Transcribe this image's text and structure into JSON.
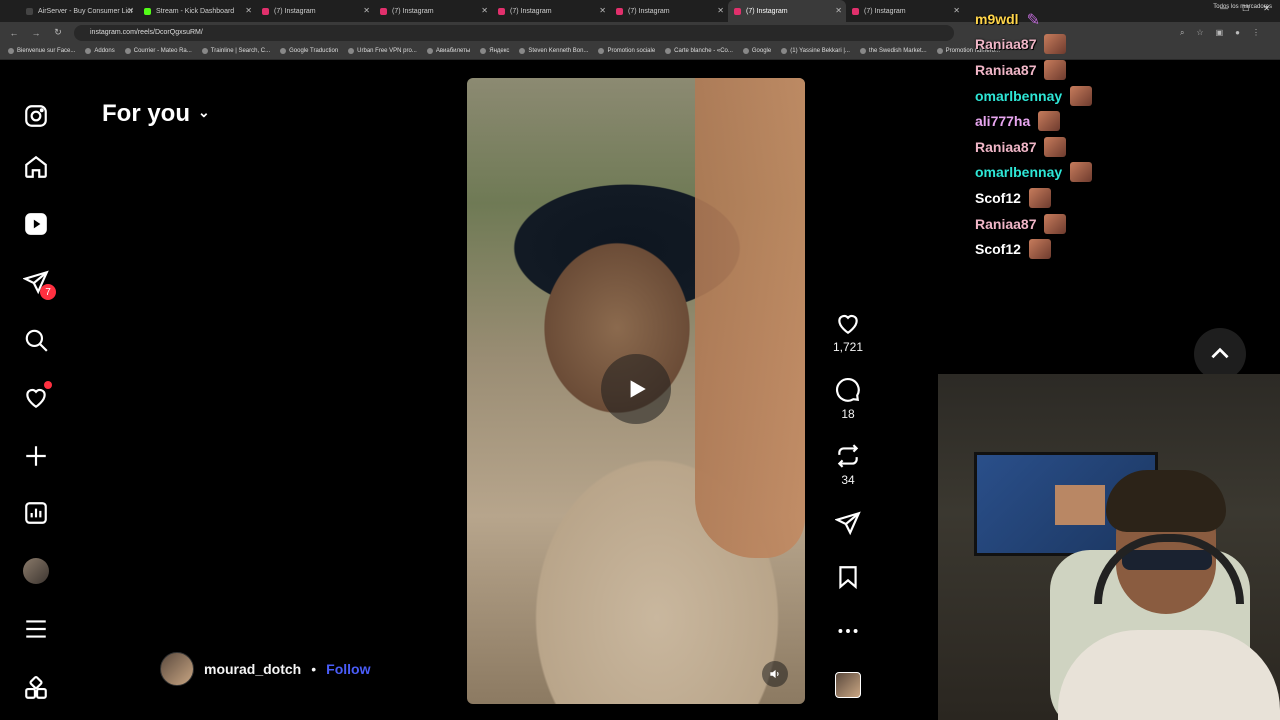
{
  "browser": {
    "tabs": [
      {
        "label": "AirServer - Buy Consumer Licr",
        "color": "#444444"
      },
      {
        "label": "Stream - Kick Dashboard",
        "color": "#53fc18"
      },
      {
        "label": "(7) Instagram",
        "color": "#e1306c"
      },
      {
        "label": "(7) Instagram",
        "color": "#e1306c"
      },
      {
        "label": "(7) Instagram",
        "color": "#e1306c"
      },
      {
        "label": "(7) Instagram",
        "color": "#e1306c"
      },
      {
        "label": "(7) Instagram",
        "color": "#e1306c",
        "active": true
      },
      {
        "label": "(7) Instagram",
        "color": "#e1306c"
      }
    ],
    "url": "instagram.com/reels/DcorQgxsuRM/",
    "bookmarks": [
      "Bienvenue sur Face...",
      "Addons",
      "Courrier - Mateo Ra...",
      "Trainline | Search, C...",
      "Google Traduction",
      "Urban Free VPN pro...",
      "Авиабилеты",
      "Яндекс",
      "Steven Kenneth Bon...",
      "Promotion sociale",
      "Carte blanche - «Co...",
      "Google",
      "(1) Yassine Bekkari |...",
      "the Swedish Market...",
      "Promotion numéro..."
    ],
    "bookmarks_right": "Todos los marcadores"
  },
  "sidebar": {
    "items": [
      {
        "name": "instagram-logo-icon"
      },
      {
        "name": "home-icon"
      },
      {
        "name": "reels-icon"
      },
      {
        "name": "messages-icon",
        "badge": "7"
      },
      {
        "name": "search-icon"
      },
      {
        "name": "notifications-icon",
        "dot": true
      },
      {
        "name": "create-icon"
      },
      {
        "name": "dashboard-icon"
      },
      {
        "name": "profile-avatar"
      },
      {
        "name": "more-menu-icon"
      },
      {
        "name": "apps-icon"
      }
    ]
  },
  "feed": {
    "title": "For you",
    "author": {
      "username": "mourad_dotch",
      "separator": "•",
      "follow_label": "Follow"
    }
  },
  "reel": {
    "likes": "1,721",
    "comments": "18",
    "reposts": "34"
  },
  "chat": {
    "messages": [
      {
        "user": "m9wdl",
        "color": "#ffd54a",
        "emote": "feather"
      },
      {
        "user": "Raniaa87",
        "color": "#f0b6c7"
      },
      {
        "user": "Raniaa87",
        "color": "#f0b6c7"
      },
      {
        "user": "omarlbennay",
        "color": "#2ee6d6"
      },
      {
        "user": "ali777ha",
        "color": "#e8a6f0"
      },
      {
        "user": "Raniaa87",
        "color": "#f0b6c7"
      },
      {
        "user": "omarlbennay",
        "color": "#2ee6d6"
      },
      {
        "user": "Scof12",
        "color": "#ffffff"
      },
      {
        "user": "Raniaa87",
        "color": "#f0b6c7"
      },
      {
        "user": "Scof12",
        "color": "#ffffff"
      }
    ]
  },
  "colors": {
    "follow": "#4a5df9",
    "badge": "#ff3040",
    "background": "#000000"
  }
}
